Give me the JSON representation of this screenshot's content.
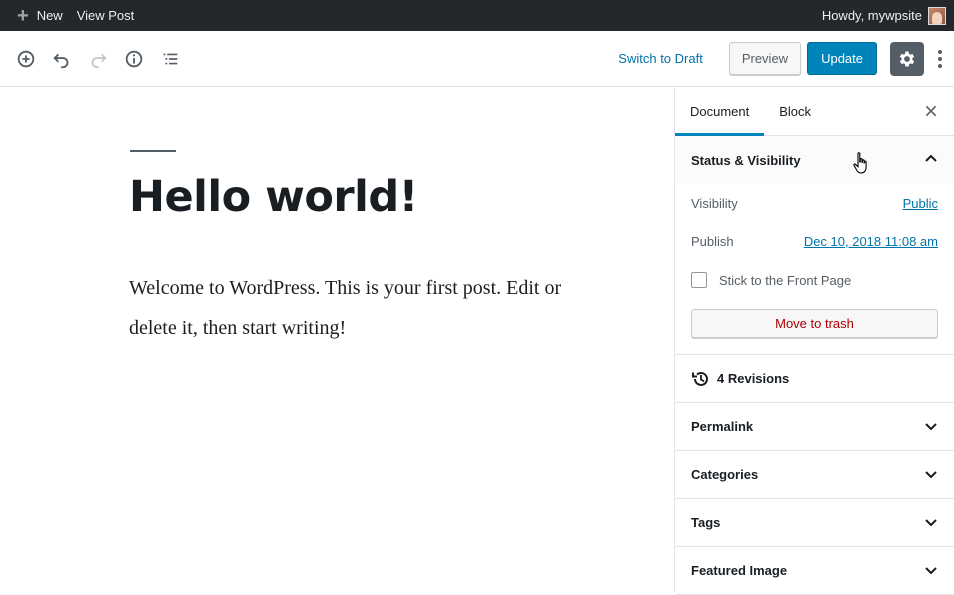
{
  "adminbar": {
    "new_label": "New",
    "view_post_label": "View Post",
    "howdy_label": "Howdy, mywpsite"
  },
  "toolbar": {
    "icons": [
      "add-block-icon",
      "undo-icon",
      "redo-icon",
      "info-icon",
      "outline-icon"
    ],
    "switch_to_draft": "Switch to Draft",
    "preview": "Preview",
    "update": "Update"
  },
  "post": {
    "title": "Hello world!",
    "content": "Welcome to WordPress. This is your first post. Edit or delete it, then start writing!"
  },
  "sidebar": {
    "tabs": [
      {
        "label": "Document",
        "active": true
      },
      {
        "label": "Block",
        "active": false
      }
    ],
    "status_visibility": {
      "title": "Status & Visibility",
      "visibility_label": "Visibility",
      "visibility_value": "Public",
      "publish_label": "Publish",
      "publish_value": "Dec 10, 2018 11:08 am",
      "sticky_label": "Stick to the Front Page",
      "trash_label": "Move to trash"
    },
    "revisions_label": "4 Revisions",
    "panels": [
      {
        "title": "Permalink"
      },
      {
        "title": "Categories"
      },
      {
        "title": "Tags"
      },
      {
        "title": "Featured Image"
      }
    ]
  },
  "colors": {
    "adminbar_bg": "#23282d",
    "primary": "#0085ba",
    "link": "#0073aa",
    "trash": "#aa0000"
  }
}
